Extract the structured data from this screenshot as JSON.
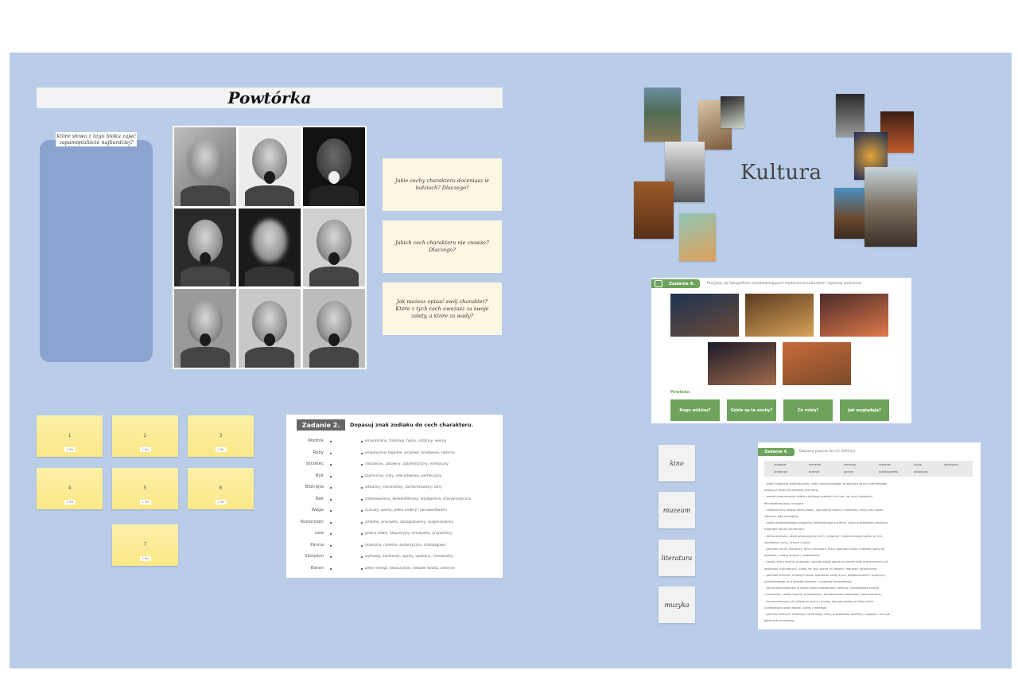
{
  "powtorka": {
    "title": "Powtórka",
    "word_panel_label": "które słowa z tego bloku zajęć zapamiętaliście najbardziej?",
    "questions": [
      "Jakie cechy charakteru doceniasz w ludziach? Dlaczego?",
      "Jakich cech charakteru nie znosisz? Dlaczego?",
      "Jak możesz opisać swój charakter? Które z tych cech uważasz za swoje zalety, a które za wady?"
    ],
    "stickies": [
      {
        "num": "1",
        "tag": "1 file"
      },
      {
        "num": "2",
        "tag": "1 file"
      },
      {
        "num": "3",
        "tag": "1 file"
      },
      {
        "num": "4",
        "tag": "1 file"
      },
      {
        "num": "5",
        "tag": "1 file"
      },
      {
        "num": "6",
        "tag": "1 file"
      },
      {
        "num": "7",
        "tag": "1 file"
      }
    ]
  },
  "zadanie2": {
    "badge": "Zadanie 2.",
    "instruction": "Dopasuj znak zodiaku do cech charakteru.",
    "signs": [
      "Wodnik",
      "Ryby",
      "Strzelec",
      "Byk",
      "Bliźnięta",
      "Rak",
      "Waga",
      "Koziorożec",
      "Lew",
      "Panna",
      "Skorpion",
      "Baran"
    ],
    "traits": [
      "emocjonalny, troskliwy, hojny, rodzinny, wierny",
      "empatyczne, łagodne, wrażliwe, kreatywne, twórcze",
      "niezależny, zabawny, optymistyczny, energiczny",
      "tajemniczy, silny, zdecydowany, perfekcyjny",
      "odważny, niecierpliwy, zainteresowany, silny",
      "zrównoważona, bezkonfliktowa, inteligentna, charyzmatyczna",
      "uczciwy, uparty, pełen ambicji i sprawiedliwości",
      "ambitny, pracowity, zaangażowany, zorganizowany",
      "pewny siebie, ekspresyjny, kreatywny, przywódczy",
      "rozważna, rzetelna, pedantyczna, drobiazgowa",
      "wytrwały, zazdrosny, uparty, spokojny, niezawodny",
      "pełne energii, towarzyskie, ciekawe świata, zmienne"
    ]
  },
  "kultura": {
    "title": "Kultura"
  },
  "zadanie6": {
    "badge": "Zadanie 6.",
    "instruction": "Przyjrzyj się fotografiom przedstawiającym wydarzenia kulturalne i wykonaj polecenia.",
    "powiedz": "Powiedz:",
    "buttons": [
      "Kogo widzisz?",
      "Gdzie są ta osoby?",
      "Co robią?",
      "Jak wyglądają?"
    ]
  },
  "word_cards": [
    "kino",
    "muzeum",
    "literatura",
    "muzyka"
  ],
  "zadanie4": {
    "badge": "Zadanie 4.",
    "instruction": "Dopasuj pojęcia do ich definicji.",
    "wordbank": [
      "autograf",
      "komedia",
      "recenzja",
      "reportaż",
      "liryka",
      "aktorstwo",
      "sceaknon",
      "dramat",
      "poezja",
      "autobiografia",
      "adaptacja"
    ],
    "definitions": [
      "- krótki fragment audiowizualny, który można oglądać za pomocą strony internetowej",
      "produkcji przed jej oficjalną premierą;",
      "- proces przenoszenia dzieła z jednego medium na inne, np. przy tworzeniu",
      "filmów/ekranizacji na bazie;",
      "- elektroniczny podpis danej osoby, najczęściej twórcy i celebryty, który jest często",
      "zbierany jako pamiątka;",
      "- część widowiskowego programu telewizyjnego lub filmu, która przedstawia określony",
      "fragment fabuły lub tematu;",
      "- forma literacka, która wykorzystuje rytm, metaforę i instrumentacje głosu w celu",
      "wyrażenia uczuć, emocji i myśli;",
      "- gatunek sztuki, literatury, filmu lub teatru, który poprzez humor i zabawę stara się",
      "wywołać u widza śmiech i rozbawienie;",
      "- osoba, która ocenia, analizuje i wyraża swoje opinie na temat dzieł artystycznych lub",
      "wydarzeń kulturalnych, mając na celu ocenę ich jakości i wartości artystycznej;",
      "- gatunek literacki, w którym autor opowiada swoje życie, doświadczenia i przeżycia,",
      "przedstawiając je w sposób osobisty i z własnej perspektywy;",
      "- forma dziennikarska, w której autor przedstawia rzetelną i szczegółową relację",
      "z wydarzeń, często opartą na badaniach, świadectwach świadków i obserwacjach;",
      "- forma pisemnej lub mówionej oceny i analizy danego dzieła, w której autor",
      "przedstawia swoje zdanie, oceny i refleksje;",
      "- gatunek literacki, teatralny lub filmowy, który przedstawia konflikty, napięcia i emocje",
      "głównych bohaterów."
    ]
  }
}
